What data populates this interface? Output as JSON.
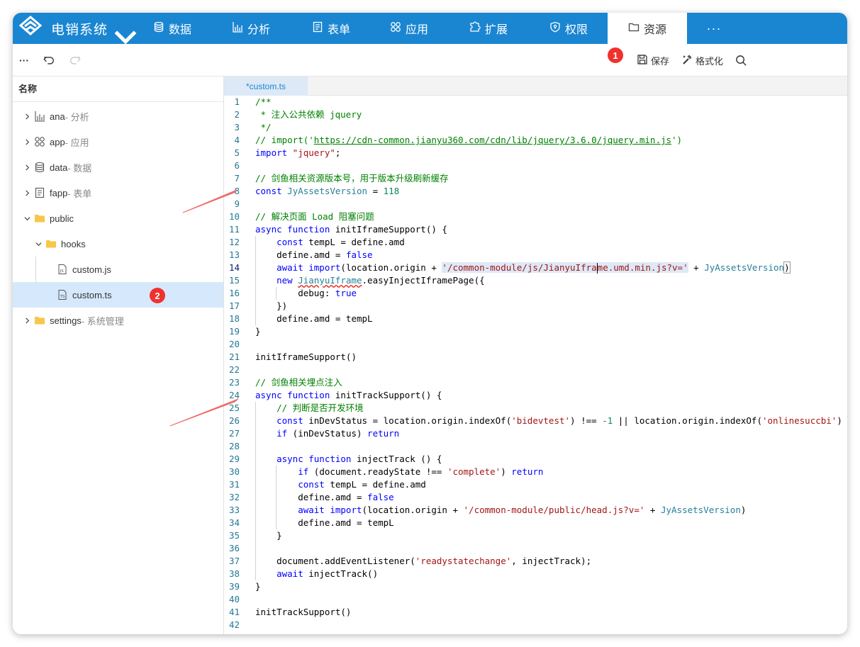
{
  "app": {
    "title": "电销系统"
  },
  "nav": [
    {
      "label": "数据",
      "icon": "database-icon"
    },
    {
      "label": "分析",
      "icon": "bar-chart-icon"
    },
    {
      "label": "表单",
      "icon": "form-icon"
    },
    {
      "label": "应用",
      "icon": "apps-icon"
    },
    {
      "label": "扩展",
      "icon": "extension-icon"
    },
    {
      "label": "权限",
      "icon": "shield-icon"
    },
    {
      "label": "资源",
      "icon": "folder-icon",
      "active": true
    }
  ],
  "nav_more": "···",
  "toolbar": {
    "more": "···",
    "save_label": "保存",
    "format_label": "格式化",
    "badge1": "1",
    "badge2": "2"
  },
  "sidebar": {
    "header": "名称",
    "items": [
      {
        "name": "ana",
        "desc": " - 分析"
      },
      {
        "name": "app",
        "desc": " - 应用"
      },
      {
        "name": "data",
        "desc": " - 数据"
      },
      {
        "name": "fapp",
        "desc": " - 表单"
      },
      {
        "name": "public",
        "desc": ""
      },
      {
        "name": "hooks",
        "desc": ""
      },
      {
        "name": "custom.js",
        "desc": ""
      },
      {
        "name": "custom.ts",
        "desc": ""
      },
      {
        "name": "settings",
        "desc": " - 系统管理"
      }
    ]
  },
  "editor": {
    "tab_label": "*custom.ts",
    "line_numbers": [
      "1",
      "2",
      "3",
      "4",
      "5",
      "6",
      "7",
      "8",
      "9",
      "10",
      "11",
      "12",
      "13",
      "14",
      "15",
      "16",
      "17",
      "18",
      "19",
      "20",
      "21",
      "22",
      "23",
      "24",
      "25",
      "26",
      "27",
      "28",
      "29",
      "30",
      "31",
      "32",
      "33",
      "34",
      "35",
      "36",
      "37",
      "38",
      "39",
      "40",
      "41",
      "42"
    ],
    "code": {
      "l1": "/**",
      "l2": " * 注入公共依赖 jquery",
      "l3": " */",
      "l4a": "// import('",
      "l4b": "https://cdn-common.jianyu360.com/cdn/lib/jquery/3.6.0/jquery.min.js",
      "l4c": "')",
      "l5a": "import",
      "l5b": " \"jquery\"",
      "l5c": ";",
      "l7": "// 剑鱼相关资源版本号，用于版本升级刷新缓存",
      "l8a": "const",
      "l8b": " JyAssetsVersion",
      "l8c": " = ",
      "l8d": "118",
      "l10": "// 解决页面 Load 阻塞问题",
      "l11a": "async function",
      "l11b": " initIframeSupport() {",
      "l12a": "    const",
      "l12b": " tempL = define.amd",
      "l13a": "    define.amd = ",
      "l13b": "false",
      "l14a": "    await import",
      "l14b": "(location.origin + ",
      "l14c": "'/common-module/js/JianyuIfra",
      "l14d": "me.umd.min.js?v='",
      "l14e": " + ",
      "l14f": "JyAssetsVersion",
      "l14g": ")",
      "l15a": "    new ",
      "l15b": "JianyuIframe",
      "l15c": ".easyInjectIframePage({",
      "l16a": "        debug: ",
      "l16b": "true",
      "l17": "    })",
      "l18": "    define.amd = tempL",
      "l19": "}",
      "l21": "initIframeSupport()",
      "l23": "// 剑鱼相关埋点注入",
      "l24a": "async function",
      "l24b": " initTrackSupport() {",
      "l25": "    // 判断是否开发环境",
      "l26a": "    const",
      "l26b": " inDevStatus = location.origin.indexOf(",
      "l26c": "'bidevtest'",
      "l26d": ") !== ",
      "l26e": "-1",
      "l26f": " || location.origin.indexOf(",
      "l26g": "'onlinesuccbi'",
      "l26h": ") !== -",
      "l27a": "    if",
      "l27b": " (inDevStatus) ",
      "l27c": "return",
      "l29a": "    async function",
      "l29b": " injectTrack () {",
      "l30a": "        if",
      "l30b": " (document.readyState !== ",
      "l30c": "'complete'",
      "l30d": ") ",
      "l30e": "return",
      "l31a": "        const",
      "l31b": " tempL = define.amd",
      "l32a": "        define.amd = ",
      "l32b": "false",
      "l33a": "        await import",
      "l33b": "(location.origin + ",
      "l33c": "'/common-module/public/head.js?v='",
      "l33d": " + ",
      "l33e": "JyAssetsVersion",
      "l33f": ")",
      "l34": "        define.amd = tempL",
      "l35": "    }",
      "l37a": "    document.addEventListener(",
      "l37b": "'readystatechange'",
      "l37c": ", injectTrack);",
      "l38a": "    await",
      "l38b": " injectTrack()",
      "l39": "}",
      "l41": "initTrackSupport()"
    }
  },
  "colors": {
    "nav_bg": "#1a86d1",
    "badge": "#f0312c",
    "selected_row": "#d6e8fb",
    "annotation_arrow": "#ef6b6b"
  }
}
